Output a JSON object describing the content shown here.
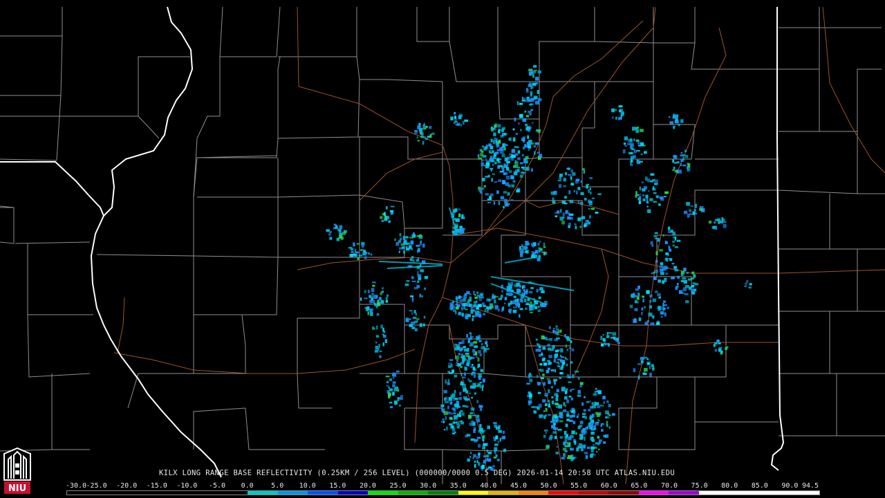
{
  "caption": "KILX LONG RANGE BASE REFLECTIVITY (0.25KM / 256 LEVEL) (000000/0000 0.5 DEG) 2026-01-14 20:58 UTC  ATLAS.NIU.EDU",
  "scale": {
    "ticks": [
      "-30.0",
      "-25.0",
      "-20.0",
      "-15.0",
      "-10.0",
      "-5.0",
      "0.0",
      "5.0",
      "10.0",
      "15.0",
      "20.0",
      "25.0",
      "30.0",
      "35.0",
      "40.0",
      "45.0",
      "50.0",
      "55.0",
      "60.0",
      "65.0",
      "70.0",
      "75.0",
      "80.0",
      "85.0",
      "90.0",
      "94.5"
    ],
    "colors": [
      "#000000",
      "#000000",
      "#000000",
      "#000000",
      "#000000",
      "#000000",
      "#00c8c8",
      "#0096e6",
      "#0050ff",
      "#0000c8",
      "#00e600",
      "#00b400",
      "#008200",
      "#ffff00",
      "#e6b400",
      "#ff8200",
      "#ff0000",
      "#c80000",
      "#960000",
      "#ff00ff",
      "#a000d8",
      "#ffffff",
      "#ffffff",
      "#ffffff",
      "#ffffff"
    ]
  },
  "logo": {
    "text": "NIU",
    "colors": {
      "red": "#c8102e",
      "white": "#ffffff"
    }
  },
  "map": {
    "colors": {
      "county": "#9a9a9a",
      "state": "#ffffff",
      "highway": "#a0522d",
      "echo_light": "#1e90ff",
      "echo_mid": "#00c0e0",
      "echo_heavy": "#2ed84a"
    }
  }
}
